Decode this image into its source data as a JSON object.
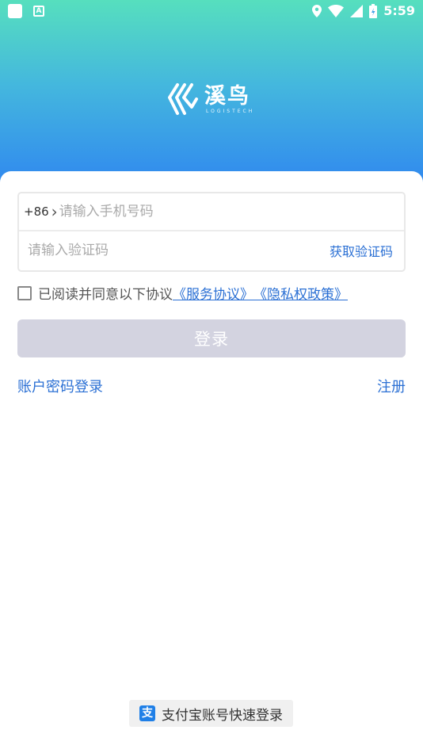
{
  "status_bar": {
    "time": "5:59",
    "left_icons": [
      "notification-square-icon",
      "a-box-icon"
    ],
    "right_icons": [
      "location-icon",
      "wifi-icon",
      "signal-icon",
      "battery-icon"
    ]
  },
  "logo": {
    "name_cn": "溪鸟",
    "name_en": "LOGISTECH"
  },
  "form": {
    "country_code": "+86",
    "phone_placeholder": "请输入手机号码",
    "code_placeholder": "请输入验证码",
    "get_code_label": "获取验证码"
  },
  "agreement": {
    "prefix": "已阅读并同意以下协议",
    "service_link": "《服务协议》",
    "privacy_link": "《隐私权政策》"
  },
  "login_button": "登录",
  "password_login": "账户密码登录",
  "register": "注册",
  "alipay_login": "支付宝账号快速登录",
  "colors": {
    "gradient_top": "#56dfbe",
    "gradient_bottom": "#2f86f0",
    "link": "#2b70d4",
    "login_button_disabled": "#d3d3e0"
  }
}
